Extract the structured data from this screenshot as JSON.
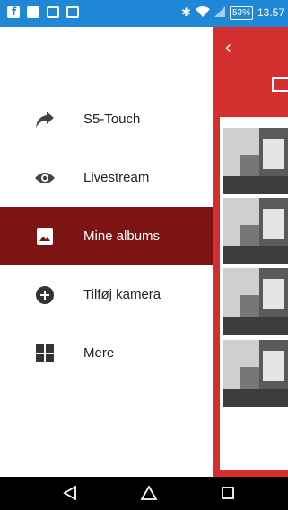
{
  "status_bar": {
    "battery": "53%",
    "time": "13.57"
  },
  "drawer": {
    "items": [
      {
        "label": "S5-Touch",
        "icon": "share-arrow-icon"
      },
      {
        "label": "Livestream",
        "icon": "eye-icon"
      },
      {
        "label": "Mine albums",
        "icon": "image-icon",
        "active": true
      },
      {
        "label": "Tilføj kamera",
        "icon": "add-circle-icon"
      },
      {
        "label": "Mere",
        "icon": "grid-icon"
      }
    ]
  },
  "colors": {
    "status_bar": "#1e88d6",
    "accent_red": "#d32f2f",
    "active_item": "#7d1414"
  }
}
